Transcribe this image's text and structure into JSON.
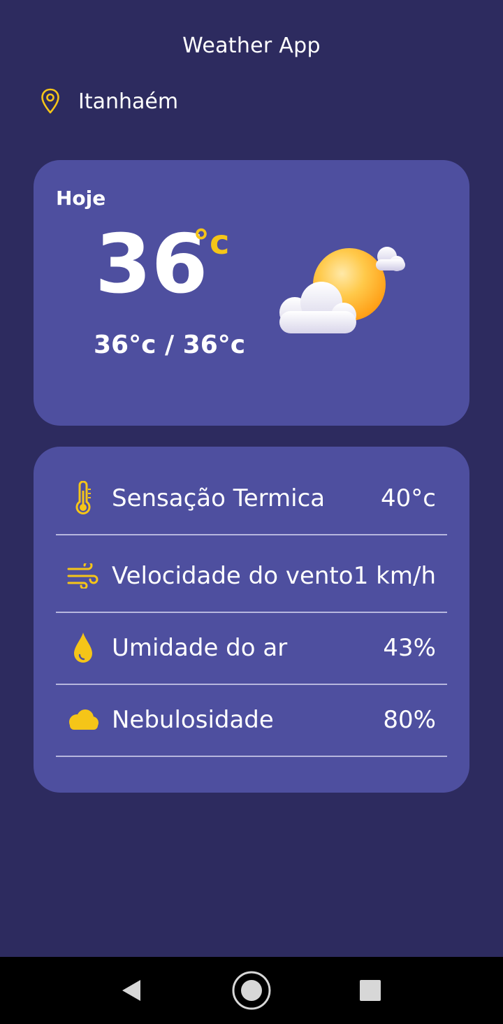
{
  "app": {
    "title": "Weather App"
  },
  "location": {
    "icon": "location-pin-icon",
    "city": "Itanhaém"
  },
  "today": {
    "label": "Hoje",
    "temperature": "36",
    "unit": "°c",
    "range": "36°c / 36°c",
    "condition_icon": "partly-cloudy-icon"
  },
  "details": [
    {
      "icon": "thermometer-icon",
      "label": "Sensação Termica",
      "value": "40°c"
    },
    {
      "icon": "wind-icon",
      "label": "Velocidade do vento",
      "value": "1 km/h"
    },
    {
      "icon": "droplet-icon",
      "label": "Umidade do ar",
      "value": "43%"
    },
    {
      "icon": "cloud-icon",
      "label": "Nebulosidade",
      "value": "80%"
    }
  ],
  "navigation": {
    "back_icon": "back-triangle-icon",
    "home_icon": "home-circle-icon",
    "recents_icon": "recents-square-icon"
  },
  "colors": {
    "background": "#2d2b5f",
    "card": "#4e4f9f",
    "accent": "#f5c518",
    "text": "#ffffff",
    "divider": "#b7b7de",
    "nav_bar": "#000000"
  }
}
